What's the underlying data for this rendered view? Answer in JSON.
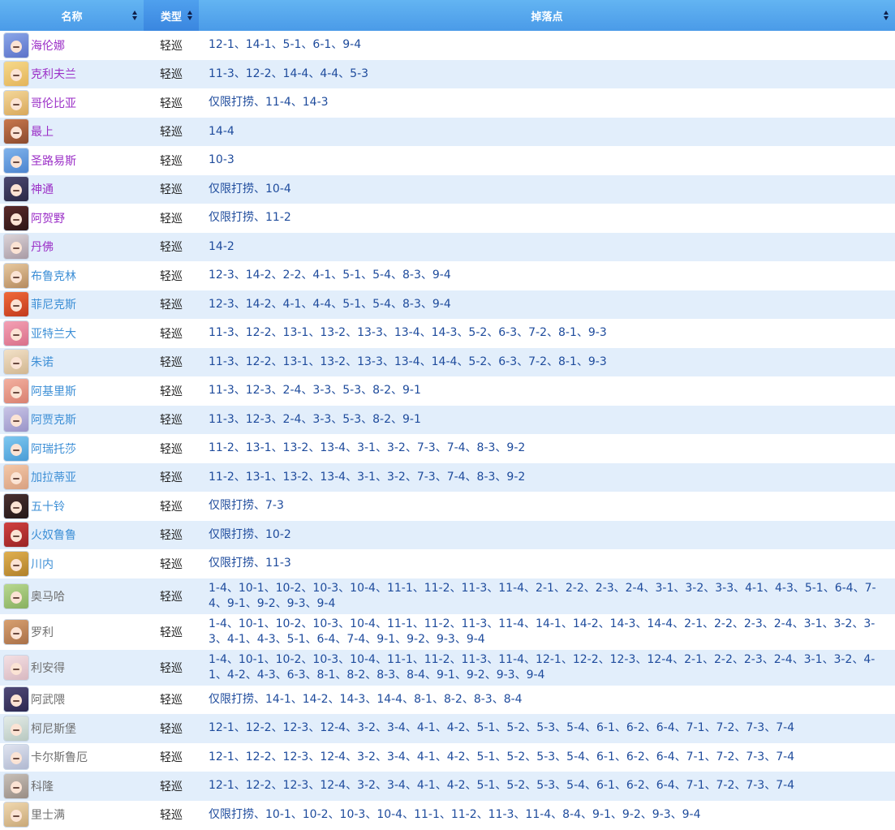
{
  "header": {
    "name_label": "名称",
    "type_label": "类型",
    "drops_label": "掉落点"
  },
  "rows": [
    {
      "name": "海伦娜",
      "type": "轻巡",
      "drops": "12-1、14-1、5-1、6-1、9-4",
      "name_color": "purple",
      "avatar": [
        "#8aa6e8",
        "#5b72c9"
      ]
    },
    {
      "name": "克利夫兰",
      "type": "轻巡",
      "drops": "11-3、12-2、14-4、4-4、5-3",
      "name_color": "purple",
      "avatar": [
        "#f6d98a",
        "#e3b45a"
      ]
    },
    {
      "name": "哥伦比亚",
      "type": "轻巡",
      "drops": "仅限打捞、11-4、14-3",
      "name_color": "purple",
      "avatar": [
        "#f4d79a",
        "#d8a85a"
      ]
    },
    {
      "name": "最上",
      "type": "轻巡",
      "drops": "14-4",
      "name_color": "purple",
      "avatar": [
        "#c9784d",
        "#8a4a2e"
      ]
    },
    {
      "name": "圣路易斯",
      "type": "轻巡",
      "drops": "10-3",
      "name_color": "purple",
      "avatar": [
        "#7fb3ec",
        "#4d85cf"
      ]
    },
    {
      "name": "神通",
      "type": "轻巡",
      "drops": "仅限打捞、10-4",
      "name_color": "purple",
      "avatar": [
        "#4b4870",
        "#2a2946"
      ]
    },
    {
      "name": "阿贺野",
      "type": "轻巡",
      "drops": "仅限打捞、11-2",
      "name_color": "purple",
      "avatar": [
        "#5a2a2a",
        "#2e1616"
      ]
    },
    {
      "name": "丹佛",
      "type": "轻巡",
      "drops": "14-2",
      "name_color": "purple",
      "avatar": [
        "#dcd4d8",
        "#a89aa4"
      ]
    },
    {
      "name": "布鲁克林",
      "type": "轻巡",
      "drops": "12-3、14-2、2-2、4-1、5-1、5-4、8-3、9-4",
      "name_color": "blue",
      "avatar": [
        "#e7c9a0",
        "#b58a5e"
      ]
    },
    {
      "name": "菲尼克斯",
      "type": "轻巡",
      "drops": "12-3、14-2、4-1、4-4、5-1、5-4、8-3、9-4",
      "name_color": "blue",
      "avatar": [
        "#f06a3a",
        "#c23a1e"
      ]
    },
    {
      "name": "亚特兰大",
      "type": "轻巡",
      "drops": "11-3、12-2、13-1、13-2、13-3、13-4、14-3、5-2、6-3、7-2、8-1、9-3",
      "name_color": "blue",
      "avatar": [
        "#f4a0b4",
        "#d9708a"
      ]
    },
    {
      "name": "朱诺",
      "type": "轻巡",
      "drops": "11-3、12-2、13-1、13-2、13-3、13-4、14-4、5-2、6-3、7-2、8-1、9-3",
      "name_color": "blue",
      "avatar": [
        "#f2e1c8",
        "#d1b690"
      ]
    },
    {
      "name": "阿基里斯",
      "type": "轻巡",
      "drops": "11-3、12-3、2-4、3-3、5-3、8-2、9-1",
      "name_color": "blue",
      "avatar": [
        "#f3b0a0",
        "#d88070"
      ]
    },
    {
      "name": "阿贾克斯",
      "type": "轻巡",
      "drops": "11-3、12-3、2-4、3-3、5-3、8-2、9-1",
      "name_color": "blue",
      "avatar": [
        "#c8c4e6",
        "#9a94c8"
      ]
    },
    {
      "name": "阿瑞托莎",
      "type": "轻巡",
      "drops": "11-2、13-1、13-2、13-4、3-1、3-2、7-3、7-4、8-3、9-2",
      "name_color": "blue",
      "avatar": [
        "#7ec8f0",
        "#4a9cd6"
      ]
    },
    {
      "name": "加拉蒂亚",
      "type": "轻巡",
      "drops": "11-2、13-1、13-2、13-4、3-1、3-2、7-3、7-4、8-3、9-2",
      "name_color": "blue",
      "avatar": [
        "#f4c8a8",
        "#d8a080"
      ]
    },
    {
      "name": "五十铃",
      "type": "轻巡",
      "drops": "仅限打捞、7-3",
      "name_color": "blue",
      "avatar": [
        "#4a3030",
        "#241818"
      ]
    },
    {
      "name": "火奴鲁鲁",
      "type": "轻巡",
      "drops": "仅限打捞、10-2",
      "name_color": "blue",
      "avatar": [
        "#d04040",
        "#9a2424"
      ]
    },
    {
      "name": "川内",
      "type": "轻巡",
      "drops": "仅限打捞、11-3",
      "name_color": "blue",
      "avatar": [
        "#e0b050",
        "#b0802a"
      ]
    },
    {
      "name": "奥马哈",
      "type": "轻巡",
      "drops": "1-4、10-1、10-2、10-3、10-4、11-1、11-2、11-3、11-4、2-1、2-2、2-3、2-4、3-1、3-2、3-3、4-1、4-3、5-1、6-4、7-4、9-1、9-2、9-3、9-4",
      "name_color": "gray",
      "avatar": [
        "#b8d890",
        "#88b060"
      ],
      "tall": true
    },
    {
      "name": "罗利",
      "type": "轻巡",
      "drops": "1-4、10-1、10-2、10-3、10-4、11-1、11-2、11-3、11-4、14-1、14-2、14-3、14-4、2-1、2-2、2-3、2-4、3-1、3-2、3-3、4-1、4-3、5-1、6-4、7-4、9-1、9-2、9-3、9-4",
      "name_color": "gray",
      "avatar": [
        "#d8a070",
        "#a87048"
      ],
      "tall": true
    },
    {
      "name": "利安得",
      "type": "轻巡",
      "drops": "1-4、10-1、10-2、10-3、10-4、11-1、11-2、11-3、11-4、12-1、12-2、12-3、12-4、2-1、2-2、2-3、2-4、3-1、3-2、4-1、4-2、4-3、6-3、8-1、8-2、8-3、8-4、9-1、9-2、9-3、9-4",
      "name_color": "gray",
      "avatar": [
        "#f4e0e4",
        "#d8b8c0"
      ],
      "tall": true
    },
    {
      "name": "阿武隈",
      "type": "轻巡",
      "drops": "仅限打捞、14-1、14-2、14-3、14-4、8-1、8-2、8-3、8-4",
      "name_color": "gray",
      "avatar": [
        "#504a78",
        "#2c2850"
      ]
    },
    {
      "name": "柯尼斯堡",
      "type": "轻巡",
      "drops": "12-1、12-2、12-3、12-4、3-2、3-4、4-1、4-2、5-1、5-2、5-3、5-4、6-1、6-2、6-4、7-1、7-2、7-3、7-4",
      "name_color": "gray",
      "avatar": [
        "#e4ece8",
        "#b8c8c0"
      ]
    },
    {
      "name": "卡尔斯鲁厄",
      "type": "轻巡",
      "drops": "12-1、12-2、12-3、12-4、3-2、3-4、4-1、4-2、5-1、5-2、5-3、5-4、6-1、6-2、6-4、7-1、7-2、7-3、7-4",
      "name_color": "gray",
      "avatar": [
        "#e0e4f0",
        "#b0b8d0"
      ]
    },
    {
      "name": "科隆",
      "type": "轻巡",
      "drops": "12-1、12-2、12-3、12-4、3-2、3-4、4-1、4-2、5-1、5-2、5-3、5-4、6-1、6-2、6-4、7-1、7-2、7-3、7-4",
      "name_color": "gray",
      "avatar": [
        "#c8c0b8",
        "#988c84"
      ]
    },
    {
      "name": "里士满",
      "type": "轻巡",
      "drops": "仅限打捞、10-1、10-2、10-3、10-4、11-1、11-2、11-3、11-4、8-4、9-1、9-2、9-3、9-4",
      "name_color": "gray",
      "avatar": [
        "#f0d8b0",
        "#c8a878"
      ]
    }
  ]
}
